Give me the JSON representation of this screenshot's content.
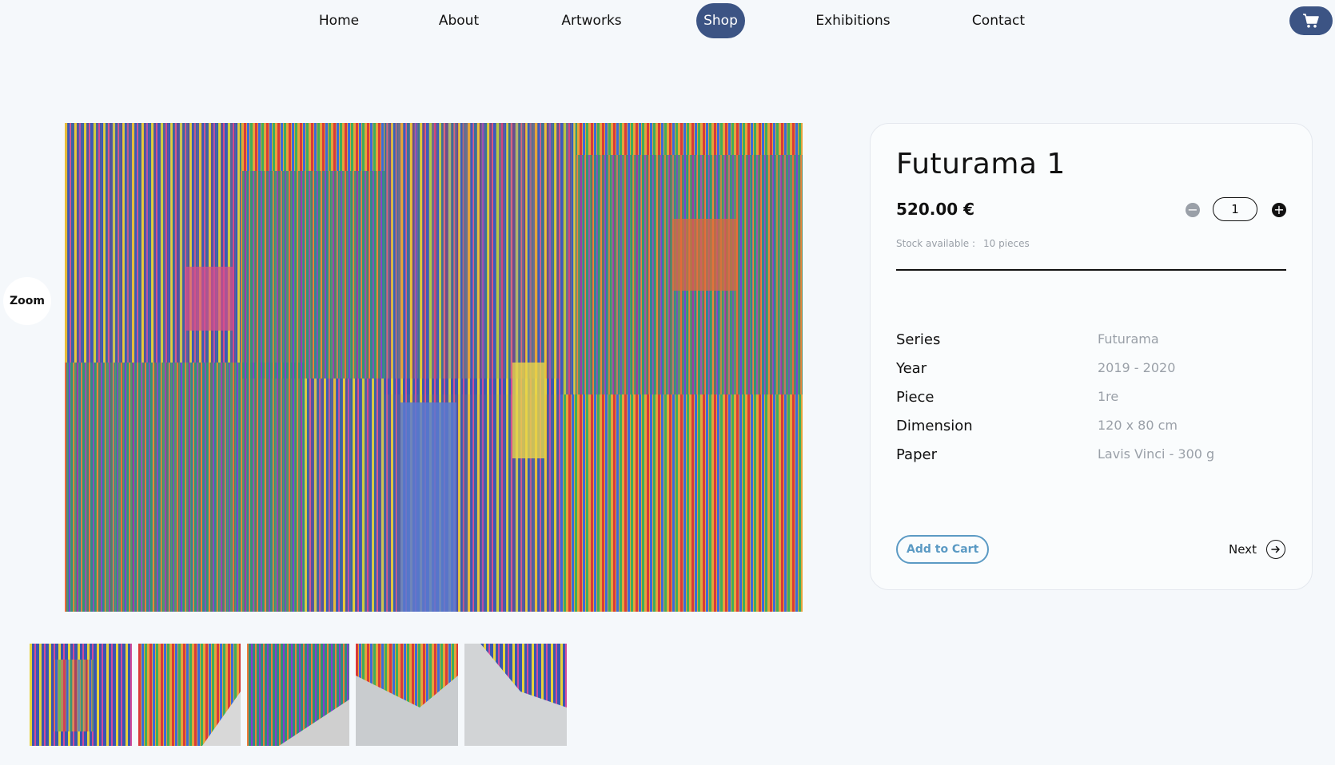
{
  "nav": {
    "items": [
      {
        "label": "Home",
        "active": false
      },
      {
        "label": "About",
        "active": false
      },
      {
        "label": "Artworks",
        "active": false
      },
      {
        "label": "Shop",
        "active": true
      },
      {
        "label": "Exhibitions",
        "active": false
      },
      {
        "label": "Contact",
        "active": false
      }
    ],
    "cart_icon": "cart-icon"
  },
  "gallery": {
    "zoom_label": "Zoom",
    "thumbnail_count": 5
  },
  "product": {
    "title": "Futurama 1",
    "price": "520.00 €",
    "quantity": "1",
    "stock_label": "Stock available :",
    "stock_value": "10 pieces",
    "specs": [
      {
        "label": "Series",
        "value": "Futurama"
      },
      {
        "label": "Year",
        "value": "2019 - 2020"
      },
      {
        "label": "Piece",
        "value": "1re"
      },
      {
        "label": "Dimension",
        "value": "120 x 80 cm"
      },
      {
        "label": "Paper",
        "value": "Lavis Vinci - 300 g"
      }
    ],
    "add_to_cart_label": "Add to Cart",
    "next_label": "Next"
  },
  "colors": {
    "accent": "#3c5484",
    "button_outline": "#5b9ac4",
    "muted_text": "#9aa0a8",
    "background": "#f5f8fb"
  }
}
